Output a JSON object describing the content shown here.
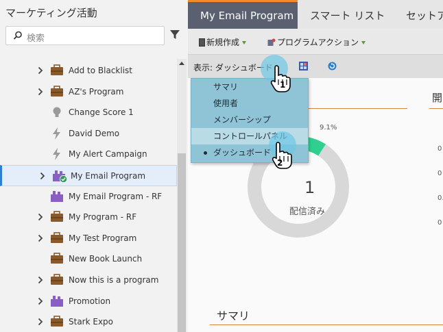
{
  "sidebar": {
    "title": "マーケティング活動",
    "search_placeholder": "検索",
    "items": [
      {
        "label": "Add to Blacklist",
        "icon": "program-briefcase-icon",
        "expandable": true
      },
      {
        "label": "AZ's Program",
        "icon": "program-briefcase-icon",
        "expandable": true
      },
      {
        "label": "Change Score 1",
        "icon": "lightbulb-icon",
        "expandable": false
      },
      {
        "label": "David Demo",
        "icon": "lightning-icon",
        "expandable": false
      },
      {
        "label": "My Alert Campaign",
        "icon": "lightning-icon",
        "expandable": false
      },
      {
        "label": "My Email Program",
        "icon": "email-program-icon",
        "expandable": true,
        "selected": true
      },
      {
        "label": "My Email Program - RF",
        "icon": "email-program-icon",
        "expandable": false
      },
      {
        "label": "My Program - RF",
        "icon": "program-briefcase-icon",
        "expandable": true
      },
      {
        "label": "My Test Program",
        "icon": "program-briefcase-icon",
        "expandable": true
      },
      {
        "label": "New Book Launch",
        "icon": "program-briefcase-icon",
        "expandable": false
      },
      {
        "label": "Now this is a program",
        "icon": "program-briefcase-icon",
        "expandable": true
      },
      {
        "label": "Promotion",
        "icon": "email-program-icon",
        "expandable": true
      },
      {
        "label": "Stark Expo",
        "icon": "program-briefcase-icon",
        "expandable": true
      }
    ]
  },
  "tabs": [
    {
      "label": "My Email Program",
      "active": true
    },
    {
      "label": "スマート リスト",
      "active": false
    },
    {
      "label": "セットア",
      "active": false
    }
  ],
  "toolbar": {
    "new_label": "新規作成",
    "actions_label": "プログラムアクション"
  },
  "subbar": {
    "view_label": "表示: ダッシュボード"
  },
  "dropdown": {
    "items": [
      {
        "label": "サマリ"
      },
      {
        "label": "使用者"
      },
      {
        "label": "メンバーシップ"
      },
      {
        "label": "コントロールパネル",
        "hover": true
      },
      {
        "label": "ダッシュボード",
        "selected": true
      }
    ]
  },
  "content": {
    "right_title": "開",
    "ticks": [
      "0",
      "0",
      "0.",
      "0"
    ],
    "summary_title": "サマリ"
  },
  "chart_data": {
    "type": "pie",
    "values": [
      9.1,
      90.9
    ],
    "slice_labels": [
      "9.1%"
    ],
    "center_value": "1",
    "center_label": "配信済み",
    "colors": [
      "#2fd08f",
      "#d8d8d8"
    ]
  },
  "callouts": [
    "1",
    "2"
  ]
}
